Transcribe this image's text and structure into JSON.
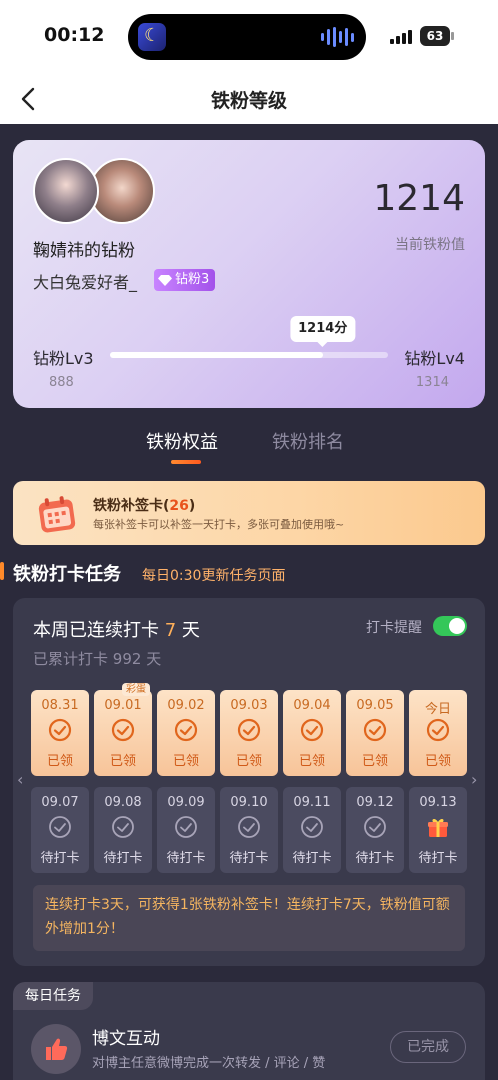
{
  "status_bar": {
    "time": "00:12",
    "battery": "63"
  },
  "nav": {
    "title": "铁粉等级"
  },
  "profile": {
    "fan_name": "鞠婧祎的钻粉",
    "nickname": "大白兔爱好者_",
    "level_badge": "钻粉3",
    "score": "1214",
    "score_label": "当前铁粉值",
    "current_level": "钻粉Lv3",
    "next_level": "钻粉Lv4",
    "current_level_min": "888",
    "next_level_min": "1314",
    "progress_tip": "1214分",
    "progress_value": 1214,
    "progress_min": 888,
    "progress_max": 1314
  },
  "tabs": [
    {
      "label": "铁粉权益",
      "active": true
    },
    {
      "label": "铁粉排名",
      "active": false
    }
  ],
  "supplement": {
    "title_prefix": "铁粉补签卡(",
    "count": "26",
    "title_suffix": ")",
    "desc": "每张补签卡可以补签一天打卡，多张可叠加使用哦~"
  },
  "section": {
    "title": "铁粉打卡任务",
    "subtitle": "每日0:30更新任务页面"
  },
  "checkin": {
    "streak_prefix": "本周已连续打卡",
    "streak_days": "7",
    "streak_suffix": "天",
    "total_prefix": "已累计打卡",
    "total_days": "992",
    "total_suffix": "天",
    "remind_label": "打卡提醒",
    "remind_on": true,
    "row1": [
      {
        "date": "08.31",
        "status": "已领",
        "tag": ""
      },
      {
        "date": "09.01",
        "status": "已领",
        "tag": "彩蛋"
      },
      {
        "date": "09.02",
        "status": "已领",
        "tag": ""
      },
      {
        "date": "09.03",
        "status": "已领",
        "tag": ""
      },
      {
        "date": "09.04",
        "status": "已领",
        "tag": ""
      },
      {
        "date": "09.05",
        "status": "已领",
        "tag": ""
      },
      {
        "date": "今日",
        "status": "已领",
        "tag": ""
      }
    ],
    "row2": [
      {
        "date": "09.07",
        "status": "待打卡",
        "icon": "check-circle-icon"
      },
      {
        "date": "09.08",
        "status": "待打卡",
        "icon": "check-circle-icon"
      },
      {
        "date": "09.09",
        "status": "待打卡",
        "icon": "check-circle-icon"
      },
      {
        "date": "09.10",
        "status": "待打卡",
        "icon": "check-circle-icon"
      },
      {
        "date": "09.11",
        "status": "待打卡",
        "icon": "check-circle-icon"
      },
      {
        "date": "09.12",
        "status": "待打卡",
        "icon": "check-circle-icon"
      },
      {
        "date": "09.13",
        "status": "待打卡",
        "icon": "gift-icon"
      }
    ],
    "tip": "连续打卡3天，可获得1张铁粉补签卡！连续打卡7天，铁粉值可额外增加1分！"
  },
  "daily": {
    "tag": "每日任务",
    "task_title": "博文互动",
    "task_desc": "对博主任意微博完成一次转发 / 评论 / 赞",
    "task_button": "已完成"
  },
  "colors": {
    "accent": "#ff8a2a",
    "background": "#2b2a3b",
    "toggle_on": "#34c759"
  }
}
